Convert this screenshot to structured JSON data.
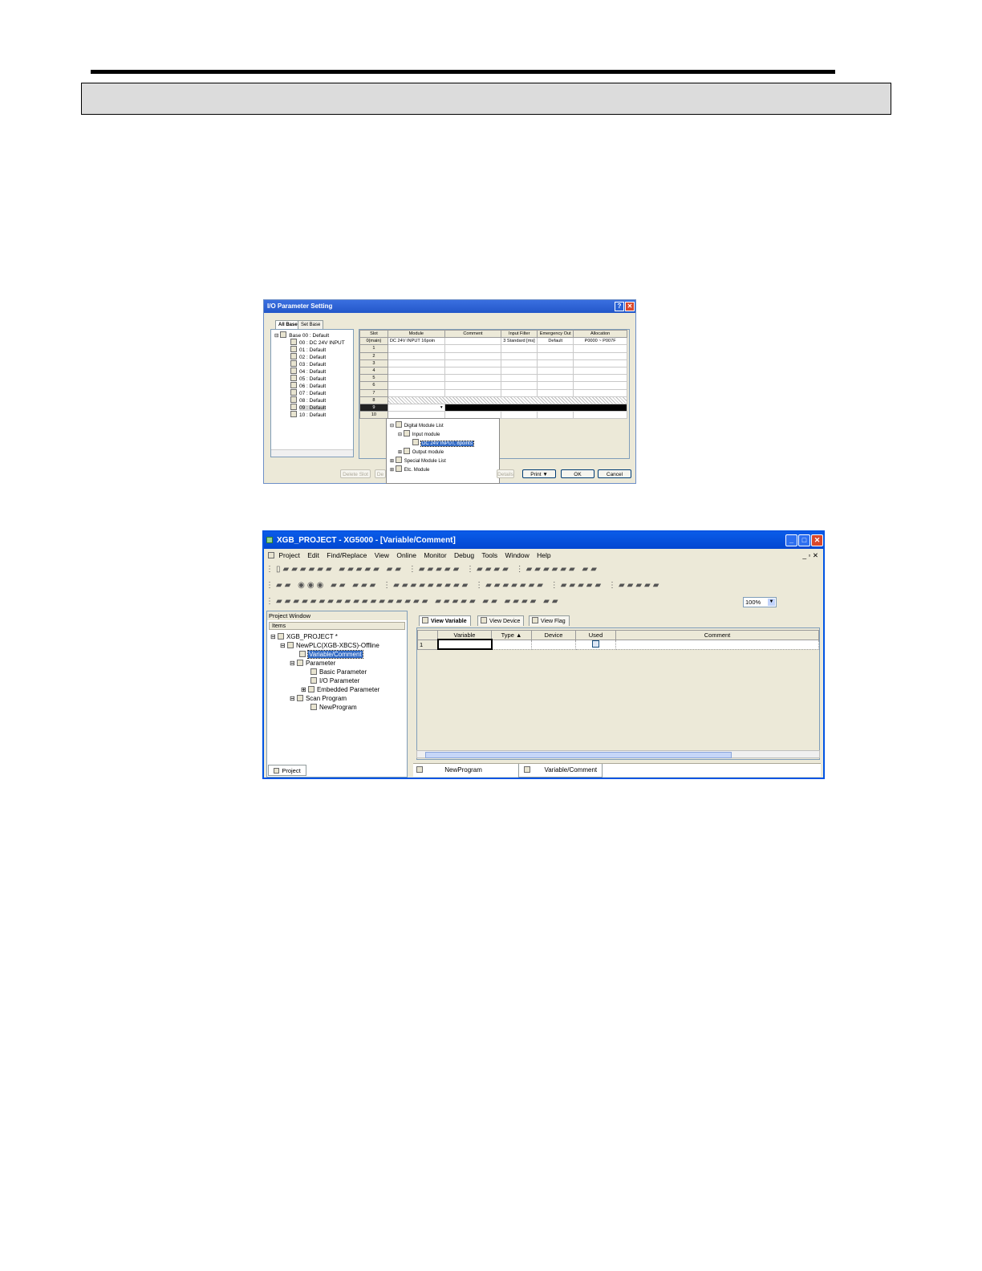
{
  "dialog1": {
    "title": "I/O Parameter Setting",
    "tabs": [
      "All Base",
      "Set Base"
    ],
    "tree": [
      "Base 00 : Default",
      "00 : DC 24V INPUT",
      "01 : Default",
      "02 : Default",
      "03 : Default",
      "04 : Default",
      "05 : Default",
      "06 : Default",
      "07 : Default",
      "08 : Default",
      "09 : Default",
      "10 : Default"
    ],
    "columns": [
      "Slot",
      "Module",
      "Comment",
      "Input Filter",
      "Emergency Out",
      "Allocation"
    ],
    "rows": [
      {
        "slot": "0(main)",
        "module": "DC 24V INPUT 16poin",
        "comment": "",
        "filter": "3 Standard [ms]",
        "emergency": "Default",
        "allocation": "P0000 ~ P007F"
      },
      {
        "slot": "1"
      },
      {
        "slot": "2"
      },
      {
        "slot": "3"
      },
      {
        "slot": "4"
      },
      {
        "slot": "5"
      },
      {
        "slot": "6"
      },
      {
        "slot": "7"
      },
      {
        "slot": "8"
      },
      {
        "slot": "9"
      },
      {
        "slot": "10"
      }
    ],
    "popup": [
      "Digital Module List",
      "Input module",
      "DC 24V INPUT, 8points",
      "Output module",
      "Special Module List",
      "Etc. Module"
    ],
    "buttons": {
      "delete_slot": "Delete Slot",
      "de": "De",
      "details": "Details",
      "print": "Print ▼",
      "ok": "OK",
      "cancel": "Cancel"
    },
    "help": "?",
    "close": "✕"
  },
  "window2": {
    "title": "XGB_PROJECT - XG5000 - [Variable/Comment]",
    "menu": [
      "Project",
      "Edit",
      "Find/Replace",
      "View",
      "Online",
      "Monitor",
      "Debug",
      "Tools",
      "Window",
      "Help"
    ],
    "zoom": "100%",
    "project_window": {
      "title": "Project Window",
      "column": "Items",
      "tree": [
        "XGB_PROJECT *",
        "NewPLC(XGB-XBCS)-Offline",
        "Variable/Comment",
        "Parameter",
        "Basic Parameter",
        "I/O Parameter",
        "Embedded Parameter",
        "Scan Program",
        "NewProgram"
      ],
      "tab": "Project"
    },
    "view_tabs": [
      "View Variable",
      "View Device",
      "View Flag"
    ],
    "columns": [
      "Variable",
      "Type",
      "Device",
      "Used",
      "Comment"
    ],
    "row_number": "1",
    "bottom_tabs": [
      "NewProgram",
      "Variable/Comment"
    ]
  }
}
